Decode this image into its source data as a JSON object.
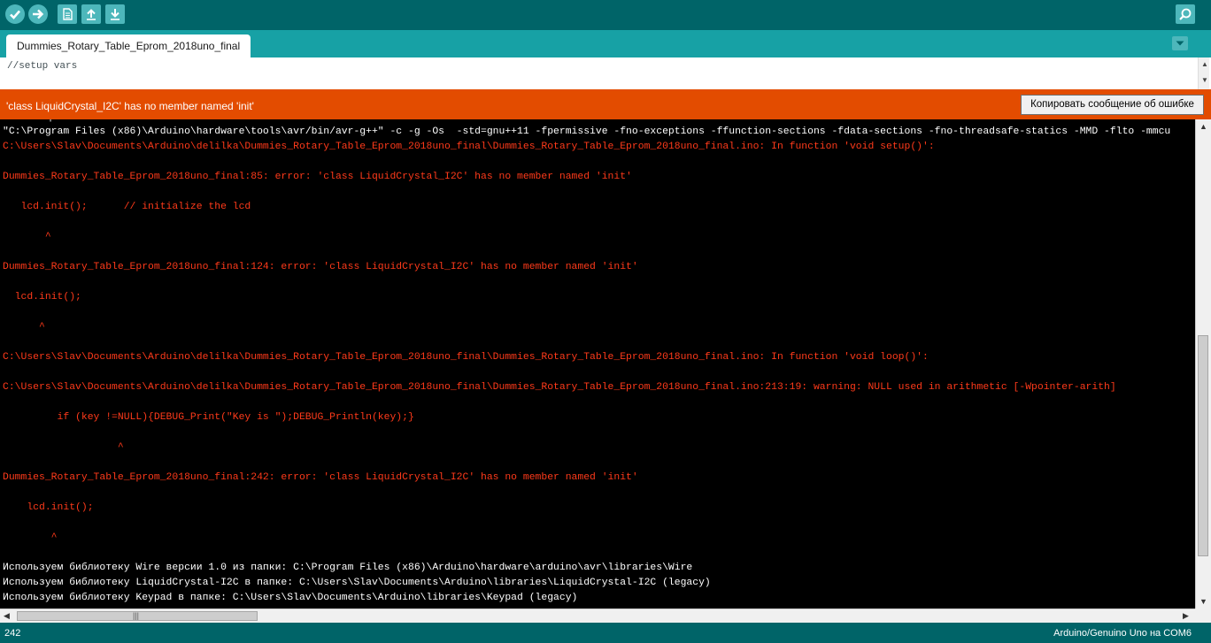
{
  "tab": {
    "label": "Dummies_Rotary_Table_Eprom_2018uno_final"
  },
  "editor": {
    "visible_line": "//setup vars"
  },
  "error_bar": {
    "message": "'class LiquidCrystal_I2C' has no member named 'init'",
    "copy_button": "Копировать сообщение об ошибке"
  },
  "console": {
    "lines": [
      {
        "text": "\"C:\\Program Files (x86)\\Arduino\\hardware\\tools\\avr/bin/avr-g++\" -c -g -Os  -std=gnu++11 -fpermissive -fno-exceptions -ffunction-sections -fdata-sections -fno-threadsafe-statics -MMD -flto -mmcu",
        "color": "white"
      },
      {
        "text": "C:\\Users\\Slav\\Documents\\Arduino\\delilka\\Dummies_Rotary_Table_Eprom_2018uno_final\\Dummies_Rotary_Table_Eprom_2018uno_final.ino: In function 'void setup()':",
        "color": "red"
      },
      {
        "text": "Dummies_Rotary_Table_Eprom_2018uno_final:85: error: 'class LiquidCrystal_I2C' has no member named 'init'",
        "color": "red"
      },
      {
        "text": "   lcd.init();      // initialize the lcd",
        "color": "red"
      },
      {
        "text": "       ^",
        "color": "red"
      },
      {
        "text": "Dummies_Rotary_Table_Eprom_2018uno_final:124: error: 'class LiquidCrystal_I2C' has no member named 'init'",
        "color": "red"
      },
      {
        "text": "  lcd.init();",
        "color": "red"
      },
      {
        "text": "      ^",
        "color": "red"
      },
      {
        "text": "C:\\Users\\Slav\\Documents\\Arduino\\delilka\\Dummies_Rotary_Table_Eprom_2018uno_final\\Dummies_Rotary_Table_Eprom_2018uno_final.ino: In function 'void loop()':",
        "color": "red"
      },
      {
        "text": "C:\\Users\\Slav\\Documents\\Arduino\\delilka\\Dummies_Rotary_Table_Eprom_2018uno_final\\Dummies_Rotary_Table_Eprom_2018uno_final.ino:213:19: warning: NULL used in arithmetic [-Wpointer-arith]",
        "color": "red"
      },
      {
        "text": "         if (key !=NULL){DEBUG_Print(\"Key is \");DEBUG_Println(key);}",
        "color": "red"
      },
      {
        "text": "                   ^",
        "color": "red"
      },
      {
        "text": "Dummies_Rotary_Table_Eprom_2018uno_final:242: error: 'class LiquidCrystal_I2C' has no member named 'init'",
        "color": "red"
      },
      {
        "text": "    lcd.init();",
        "color": "red"
      },
      {
        "text": "        ^",
        "color": "red"
      },
      {
        "text": "Используем библиотеку Wire версии 1.0 из папки: C:\\Program Files (x86)\\Arduino\\hardware\\arduino\\avr\\libraries\\Wire",
        "color": "white"
      },
      {
        "text": "Используем библиотеку LiquidCrystal-I2C в папке: C:\\Users\\Slav\\Documents\\Arduino\\libraries\\LiquidCrystal-I2C (legacy)",
        "color": "white"
      },
      {
        "text": "Используем библиотеку Keypad в папке: C:\\Users\\Slav\\Documents\\Arduino\\libraries\\Keypad (legacy)",
        "color": "white"
      }
    ]
  },
  "status": {
    "line_number": "242",
    "board": "Arduino/Genuino Uno на COM6"
  },
  "icons": {
    "verify": "check-icon",
    "upload": "arrow-right-icon",
    "new": "new-file-icon",
    "open": "open-arrow-up-icon",
    "save": "save-arrow-down-icon",
    "serial_monitor": "magnifier-icon",
    "tab_menu": "chevron-down-icon"
  },
  "colors": {
    "toolbar": "#006468",
    "tabstrip": "#17a1a5",
    "error_bar": "#e34c00",
    "console_error": "#ff3a1a"
  }
}
